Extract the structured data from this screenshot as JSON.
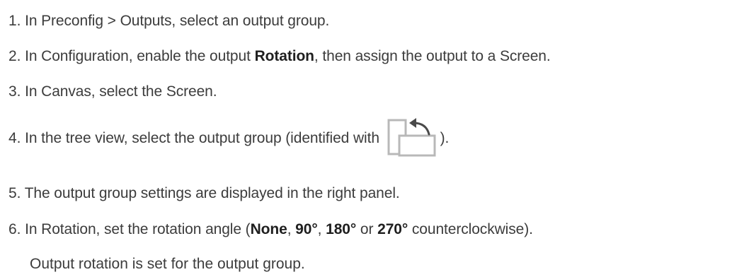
{
  "steps": [
    {
      "num": "1.",
      "text": "In Preconfig > Outputs, select an output group."
    },
    {
      "num": "2.",
      "pre": "In Configuration, enable the output ",
      "bold": "Rotation",
      "post": ", then assign the output to a Screen."
    },
    {
      "num": "3.",
      "text": "In Canvas, select the Screen."
    },
    {
      "num": "4.",
      "pre": "In the tree view, select the output group (identified with ",
      "post": ")."
    },
    {
      "num": "5.",
      "text": "The output group settings are displayed in the right panel."
    },
    {
      "num": "6.",
      "pre": "In Rotation, set the rotation angle (",
      "opt1": "None",
      "sep1": ", ",
      "opt2": "90°",
      "sep2": ", ",
      "opt3": "180°",
      "sep3": " or ",
      "opt4": "270°",
      "post": " counterclockwise)."
    }
  ],
  "result": "Output rotation is set for the output group.",
  "icon": {
    "name": "output-rotation-icon",
    "stroke": "#b8b8b8",
    "arrow": "#4a4a4a"
  }
}
